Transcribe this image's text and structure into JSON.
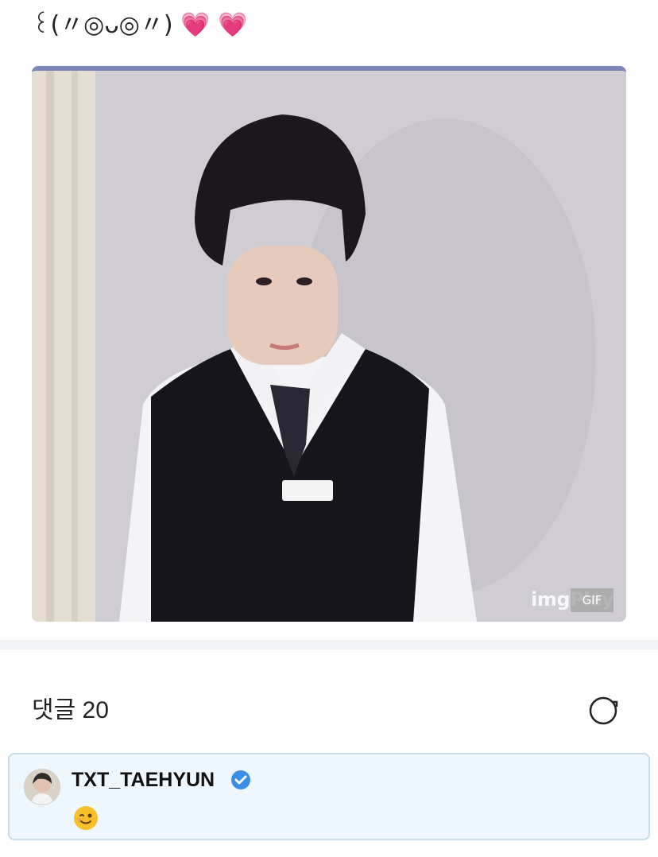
{
  "post": {
    "text": "꒰(〃◎ᴗ◎〃)",
    "emojis": [
      "💗",
      "💗"
    ],
    "media": {
      "watermark": "imgPlay",
      "badge": "GIF",
      "icon": "gif-photo"
    }
  },
  "comments": {
    "header_label": "댓글 20",
    "refresh_icon": "refresh-icon",
    "items": [
      {
        "author": "TXT_TAEHYUN",
        "verified": true,
        "body_emoji": "wink-emoji"
      }
    ]
  },
  "colors": {
    "accent_verified": "#3a8ee6",
    "comment_bg": "#eef7fd",
    "comment_border": "#c8dde8",
    "heart": "#e8509a"
  }
}
